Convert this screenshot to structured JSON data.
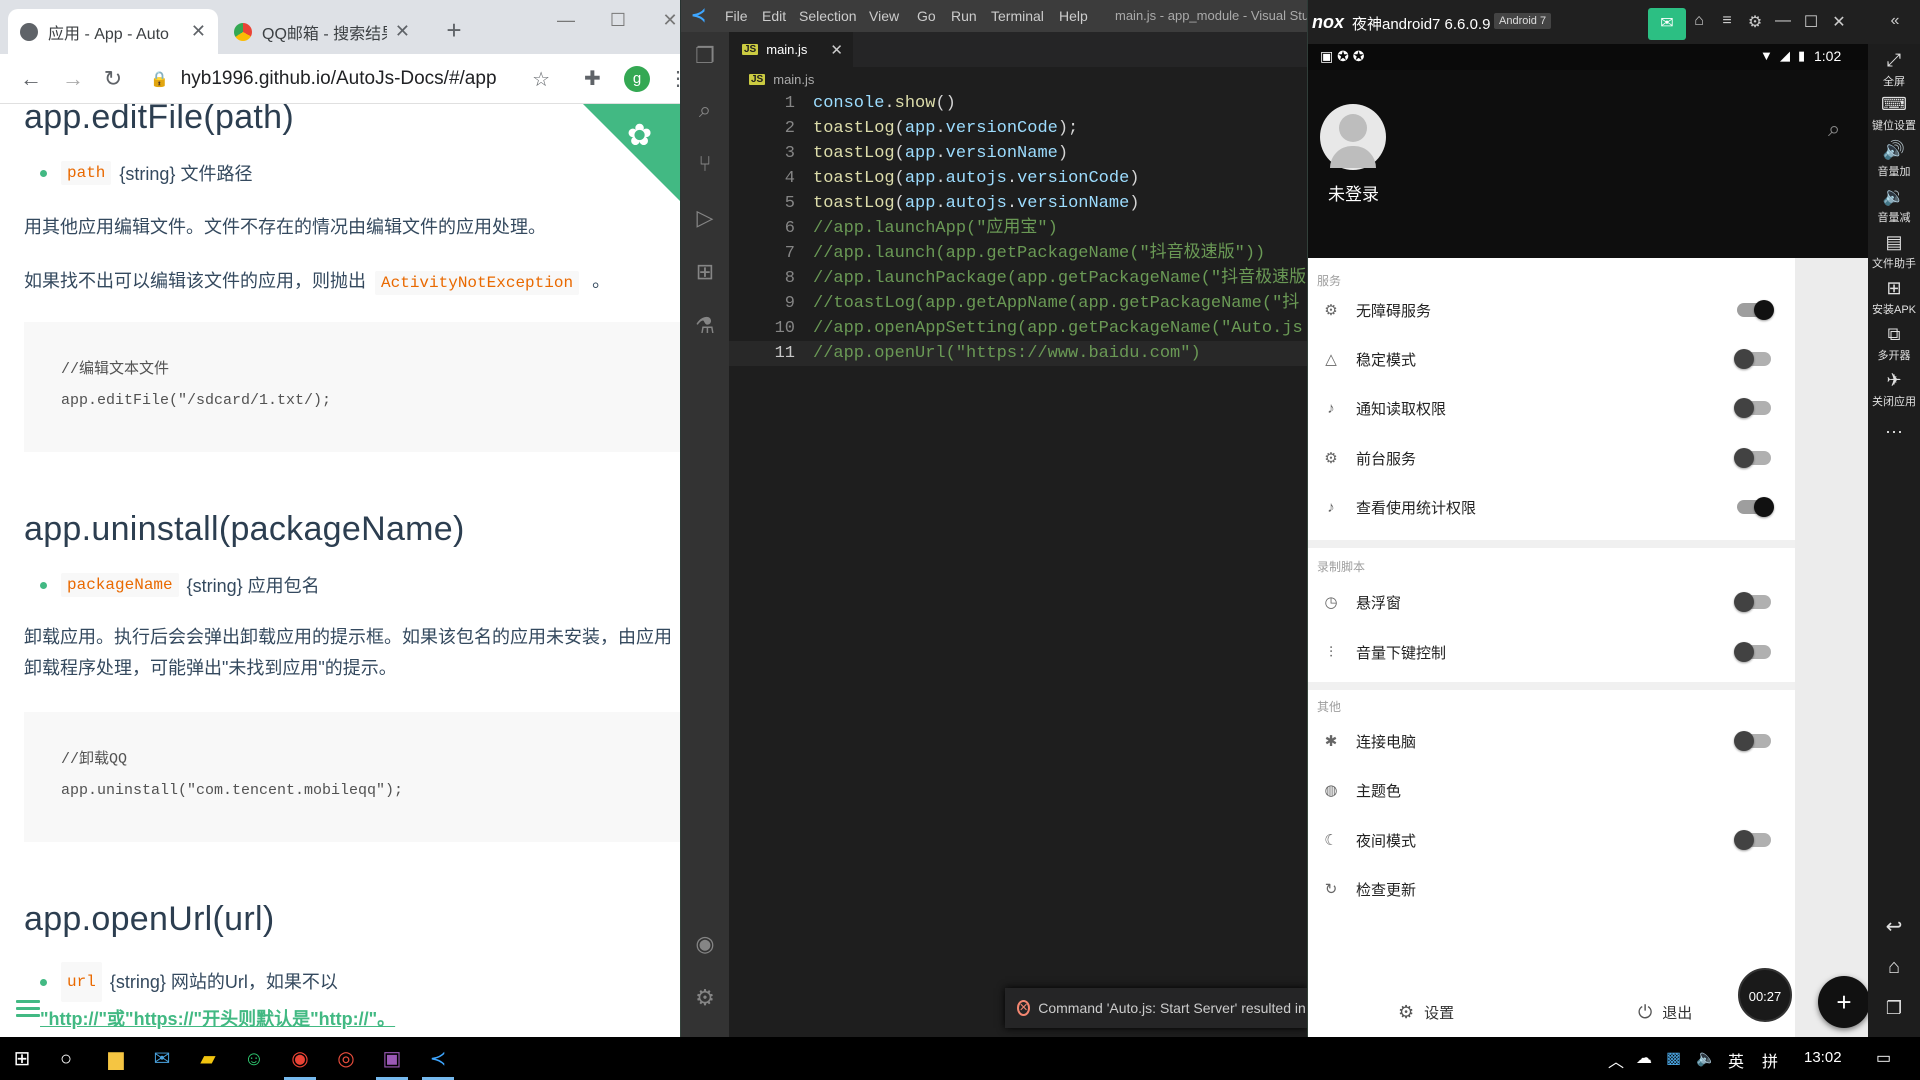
{
  "chrome": {
    "tabs": [
      {
        "title": "应用 - App - Auto",
        "close": "✕"
      },
      {
        "title": "QQ邮箱 - 搜索结果",
        "close": "✕"
      }
    ],
    "new_tab": "+",
    "url": "hyb1996.github.io/AutoJs-Docs/#/app",
    "profile_initial": "g"
  },
  "docs": {
    "sec1": {
      "heading": "app.editFile(path)",
      "param_name": "path",
      "param_desc": "{string} 文件路径",
      "desc": "用其他应用编辑文件。文件不存在的情况由编辑文件的应用处理。",
      "desc2_pre": "如果找不出可以编辑该文件的应用，则抛出",
      "desc2_code": "ActivityNotException",
      "desc2_post": "。",
      "code_comment": "//编辑文本文件",
      "code_line": "app.editFile(\"/sdcard/1.txt/);"
    },
    "sec2": {
      "heading": "app.uninstall(packageName)",
      "param_name": "packageName",
      "param_desc": "{string} 应用包名",
      "desc": "卸载应用。执行后会会弹出卸载应用的提示框。如果该包名的应用未安装，由应用卸载程序处理，可能弹出\"未找到应用\"的提示。",
      "code_comment": "//卸载QQ",
      "code_line": "app.uninstall(\"com.tencent.mobileqq\");"
    },
    "sec3": {
      "heading": "app.openUrl(url)",
      "param_name": "url",
      "param_desc": "{string} 网站的Url，如果不以",
      "param_link": "\"http://\"或\"https://\"开头则默认是\"http://\"。"
    }
  },
  "vscode": {
    "menu": [
      "File",
      "Edit",
      "Selection",
      "View",
      "Go",
      "Run",
      "Terminal",
      "Help"
    ],
    "title": "main.js - app_module - Visual Stuc",
    "tab_label": "main.js",
    "breadcrumb": "main.js",
    "lines": [
      {
        "n": "1",
        "parts": [
          [
            "c-id",
            "console"
          ],
          [
            "c-pl",
            "."
          ],
          [
            "c-fn",
            "show"
          ],
          [
            "c-pl",
            "()"
          ]
        ]
      },
      {
        "n": "2",
        "parts": [
          [
            "c-fn",
            "toastLog"
          ],
          [
            "c-pl",
            "("
          ],
          [
            "c-id",
            "app"
          ],
          [
            "c-pl",
            "."
          ],
          [
            "c-id",
            "versionCode"
          ],
          [
            "c-pl",
            ");"
          ]
        ]
      },
      {
        "n": "3",
        "parts": [
          [
            "c-fn",
            "toastLog"
          ],
          [
            "c-pl",
            "("
          ],
          [
            "c-id",
            "app"
          ],
          [
            "c-pl",
            "."
          ],
          [
            "c-id",
            "versionName"
          ],
          [
            "c-pl",
            ")"
          ]
        ]
      },
      {
        "n": "4",
        "parts": [
          [
            "c-fn",
            "toastLog"
          ],
          [
            "c-pl",
            "("
          ],
          [
            "c-id",
            "app"
          ],
          [
            "c-pl",
            "."
          ],
          [
            "c-id",
            "autojs"
          ],
          [
            "c-pl",
            "."
          ],
          [
            "c-id",
            "versionCode"
          ],
          [
            "c-pl",
            ")"
          ]
        ]
      },
      {
        "n": "5",
        "parts": [
          [
            "c-fn",
            "toastLog"
          ],
          [
            "c-pl",
            "("
          ],
          [
            "c-id",
            "app"
          ],
          [
            "c-pl",
            "."
          ],
          [
            "c-id",
            "autojs"
          ],
          [
            "c-pl",
            "."
          ],
          [
            "c-id",
            "versionName"
          ],
          [
            "c-pl",
            ")"
          ]
        ]
      },
      {
        "n": "6",
        "parts": [
          [
            "c-cm",
            "//app.launchApp(\"应用宝\")"
          ]
        ]
      },
      {
        "n": "7",
        "parts": [
          [
            "c-cm",
            "//app.launch(app.getPackageName(\"抖音极速版\"))"
          ]
        ]
      },
      {
        "n": "8",
        "parts": [
          [
            "c-cm",
            "//app.launchPackage(app.getPackageName(\"抖音极速版"
          ]
        ]
      },
      {
        "n": "9",
        "parts": [
          [
            "c-cm",
            "//toastLog(app.getAppName(app.getPackageName(\"抖"
          ]
        ]
      },
      {
        "n": "10",
        "parts": [
          [
            "c-cm",
            "//app.openAppSetting(app.getPackageName(\"Auto.js"
          ]
        ]
      },
      {
        "n": "11",
        "parts": [
          [
            "c-cm",
            "//app.openUrl(\"https://www.baidu.com\")"
          ]
        ]
      }
    ],
    "toast": "Command 'Auto.js: Start Server' resulted in a"
  },
  "nox": {
    "name": "夜神android7 6.6.0.9",
    "android_badge": "Android 7",
    "status_time": "1:02",
    "login_label": "未登录",
    "sections": [
      {
        "title": "服务",
        "items": [
          {
            "label": "无障碍服务",
            "icon": "gear-icon",
            "glyph": "⚙",
            "toggle": "on"
          },
          {
            "label": "稳定模式",
            "icon": "triangle-icon",
            "glyph": "△",
            "toggle": "off"
          },
          {
            "label": "通知读取权限",
            "icon": "bell-icon",
            "glyph": "♪",
            "toggle": "off"
          },
          {
            "label": "前台服务",
            "icon": "gear-icon",
            "glyph": "⚙",
            "toggle": "off"
          },
          {
            "label": "查看使用统计权限",
            "icon": "bell-icon",
            "glyph": "♪",
            "toggle": "on"
          }
        ]
      },
      {
        "title": "录制脚本",
        "items": [
          {
            "label": "悬浮窗",
            "icon": "clock-icon",
            "glyph": "◷",
            "toggle": "off"
          },
          {
            "label": "音量下键控制",
            "icon": "volume-icon",
            "glyph": "⫶",
            "toggle": "off"
          }
        ]
      },
      {
        "title": "其他",
        "items": [
          {
            "label": "连接电脑",
            "icon": "bug-icon",
            "glyph": "✱",
            "toggle": "off"
          },
          {
            "label": "主题色",
            "icon": "palette-icon",
            "glyph": "◍",
            "toggle": "none"
          },
          {
            "label": "夜间模式",
            "icon": "moon-icon",
            "glyph": "☾",
            "toggle": "off"
          },
          {
            "label": "检查更新",
            "icon": "refresh-icon",
            "glyph": "↻",
            "toggle": "none"
          }
        ]
      }
    ],
    "footer_settings": "设置",
    "footer_exit": "退出",
    "timer": "00:27",
    "side_buttons": [
      {
        "label": "全屏",
        "glyph": "⤢"
      },
      {
        "label": "键位设置",
        "glyph": "⌨"
      },
      {
        "label": "音量加",
        "glyph": "🔊"
      },
      {
        "label": "音量减",
        "glyph": "🔉"
      },
      {
        "label": "文件助手",
        "glyph": "▤"
      },
      {
        "label": "安装APK",
        "glyph": "⊞"
      },
      {
        "label": "多开器",
        "glyph": "⧉"
      },
      {
        "label": "关闭应用",
        "glyph": "✈"
      }
    ]
  },
  "taskbar": {
    "time": "13:02",
    "ime": "英",
    "ime2": "拼"
  }
}
